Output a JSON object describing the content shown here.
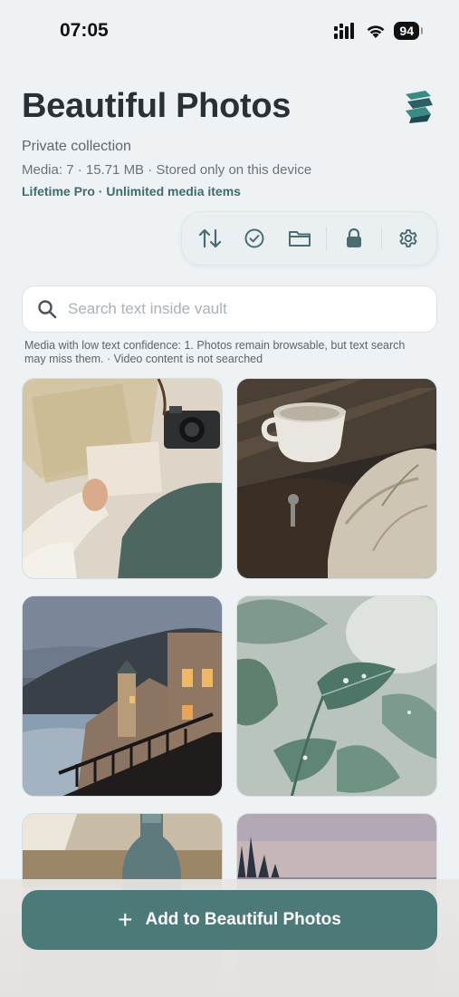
{
  "status_bar": {
    "time": "07:05",
    "battery": "94"
  },
  "header": {
    "title": "Beautiful Photos",
    "subtitle": "Private collection",
    "meta": "Media: 7 · 15.71 MB · Stored only on this device",
    "plan": "Lifetime Pro · Unlimited media items"
  },
  "toolbar": {
    "items": [
      "sort-icon",
      "select-icon",
      "folder-icon",
      "lock-icon",
      "settings-icon"
    ]
  },
  "search": {
    "placeholder": "Search text inside vault"
  },
  "notice": "Media with low text confidence: 1. Photos remain browsable, but text search may miss them. · Video content is not searched",
  "photos": [
    "travel-flatlay",
    "coffee-cup-linen",
    "coastal-village",
    "green-leaves",
    "glass-bottle",
    "sunset-trees"
  ],
  "footer": {
    "add_label": "Add to Beautiful Photos",
    "add_icon": "+"
  },
  "colors": {
    "accent": "#4b7a79",
    "plan_text": "#3e6c6c",
    "background": "#eef2f5"
  }
}
